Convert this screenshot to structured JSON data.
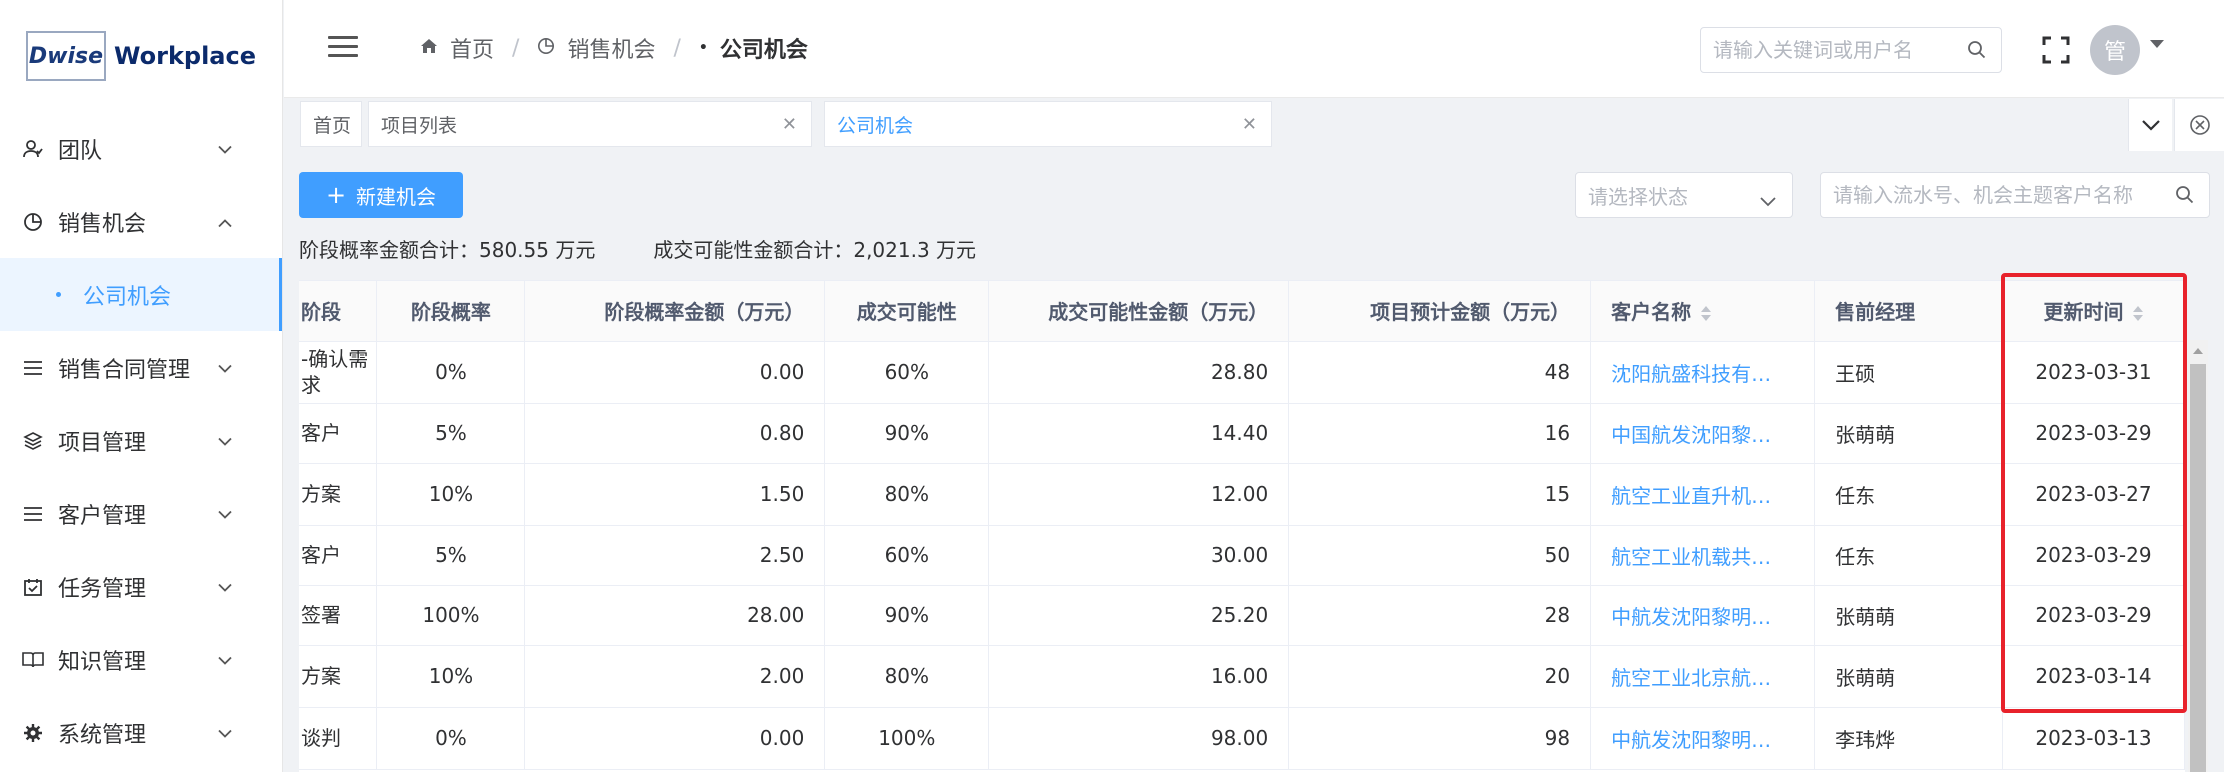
{
  "logo": {
    "brand": "Dwise",
    "title": "Workplace"
  },
  "sidebar": {
    "items": [
      {
        "label": "团队",
        "icon": "team-icon"
      },
      {
        "label": "销售机会",
        "icon": "pie-chart-icon",
        "expanded": true
      },
      {
        "label": "销售合同管理",
        "icon": "list-icon"
      },
      {
        "label": "项目管理",
        "icon": "layers-icon"
      },
      {
        "label": "客户管理",
        "icon": "list-icon"
      },
      {
        "label": "任务管理",
        "icon": "calendar-check-icon"
      },
      {
        "label": "知识管理",
        "icon": "book-icon"
      },
      {
        "label": "系统管理",
        "icon": "gear-icon"
      }
    ],
    "active_subitem": "公司机会"
  },
  "header": {
    "breadcrumb": [
      "首页",
      "销售机会",
      "公司机会"
    ],
    "search_placeholder": "请输入关键词或用户名",
    "avatar_text": "管"
  },
  "tabs": [
    {
      "label": "首页"
    },
    {
      "label": "项目列表"
    },
    {
      "label": "公司机会",
      "active": true
    }
  ],
  "toolbar": {
    "new_button": "新建机会",
    "status_placeholder": "请选择状态",
    "search_placeholder": "请输入流水号、机会主题客户名称"
  },
  "summary": {
    "stage_prob_total": "阶段概率金额合计：580.55 万元",
    "deal_prob_total": "成交可能性金额合计：2,021.3 万元"
  },
  "table": {
    "columns": [
      "阶段",
      "阶段概率",
      "阶段概率金额（万元）",
      "成交可能性",
      "成交可能性金额（万元）",
      "项目预计金额（万元）",
      "客户名称",
      "售前经理",
      "更新时间"
    ],
    "rows": [
      {
        "stage": "-确认需求",
        "stage_prob": "0%",
        "stage_amount": "0.00",
        "deal_prob": "60%",
        "deal_amount": "28.80",
        "est_amount": "48",
        "customer": "沈阳航盛科技有…",
        "manager": "王硕",
        "updated": "2023-03-31"
      },
      {
        "stage": "客户",
        "stage_prob": "5%",
        "stage_amount": "0.80",
        "deal_prob": "90%",
        "deal_amount": "14.40",
        "est_amount": "16",
        "customer": "中国航发沈阳黎…",
        "manager": "张萌萌",
        "updated": "2023-03-29"
      },
      {
        "stage": "方案",
        "stage_prob": "10%",
        "stage_amount": "1.50",
        "deal_prob": "80%",
        "deal_amount": "12.00",
        "est_amount": "15",
        "customer": "航空工业直升机…",
        "manager": "任东",
        "updated": "2023-03-27"
      },
      {
        "stage": "客户",
        "stage_prob": "5%",
        "stage_amount": "2.50",
        "deal_prob": "60%",
        "deal_amount": "30.00",
        "est_amount": "50",
        "customer": "航空工业机载共…",
        "manager": "任东",
        "updated": "2023-03-29"
      },
      {
        "stage": "签署",
        "stage_prob": "100%",
        "stage_amount": "28.00",
        "deal_prob": "90%",
        "deal_amount": "25.20",
        "est_amount": "28",
        "customer": "中航发沈阳黎明…",
        "manager": "张萌萌",
        "updated": "2023-03-29"
      },
      {
        "stage": "方案",
        "stage_prob": "10%",
        "stage_amount": "2.00",
        "deal_prob": "80%",
        "deal_amount": "16.00",
        "est_amount": "20",
        "customer": "航空工业北京航…",
        "manager": "张萌萌",
        "updated": "2023-03-14"
      },
      {
        "stage": "谈判",
        "stage_prob": "0%",
        "stage_amount": "0.00",
        "deal_prob": "100%",
        "deal_amount": "98.00",
        "est_amount": "98",
        "customer": "中航发沈阳黎明…",
        "manager": "李玮烨",
        "updated": "2023-03-13"
      }
    ]
  },
  "colors": {
    "primary": "#409eff",
    "highlight": "#e8222b",
    "avatar_bg": "#c0c4cc"
  }
}
